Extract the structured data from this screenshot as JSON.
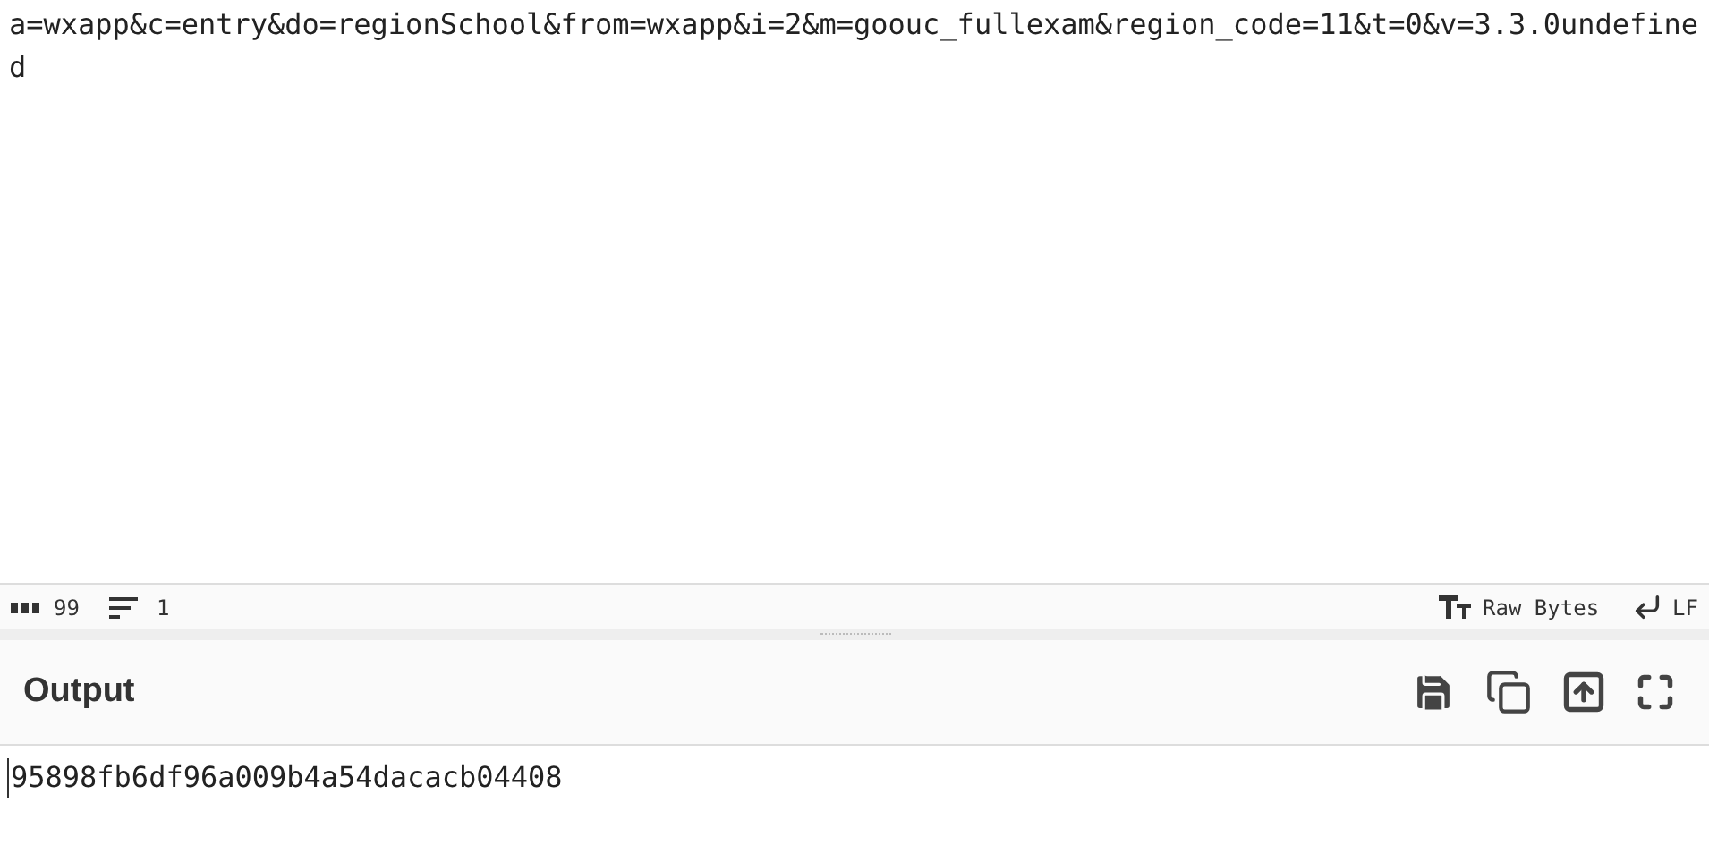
{
  "input": {
    "value": "a=wxapp&c=entry&do=regionSchool&from=wxapp&i=2&m=goouc_fullexam&region_code=11&t=0&v=3.3.0undefined"
  },
  "status_bar": {
    "length": "99",
    "lines": "1",
    "encoding": "Raw Bytes",
    "eol": "LF"
  },
  "output": {
    "title": "Output",
    "value": "95898fb6df96a009b4a54dacacb04408"
  }
}
